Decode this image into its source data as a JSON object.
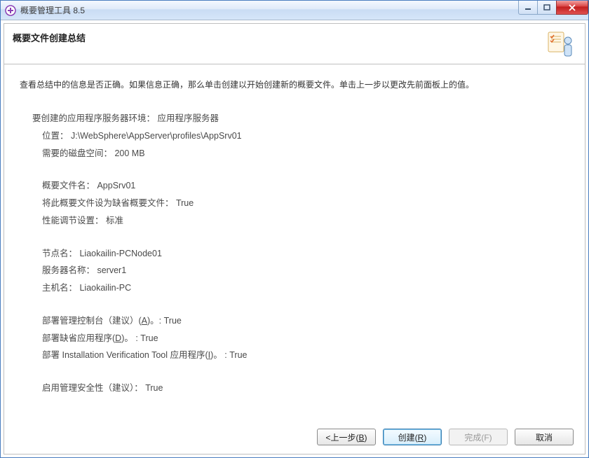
{
  "window": {
    "title": "概要管理工具 8.5"
  },
  "header": {
    "title": "概要文件创建总结"
  },
  "instruction": "查看总结中的信息是否正确。如果信息正确，那么单击创建以开始创建新的概要文件。单击上一步以更改先前面板上的值。",
  "summary": {
    "env": "要创建的应用程序服务器环境： 应用程序服务器",
    "location": "位置： J:\\WebSphere\\AppServer\\profiles\\AppSrv01",
    "disk": "需要的磁盘空间： 200 MB",
    "profileName": "概要文件名： AppSrv01",
    "defaultProfile": "将此概要文件设为缺省概要文件： True",
    "perf": "性能调节设置： 标准",
    "nodeName": "节点名： Liaokailin-PCNode01",
    "serverName": "服务器名称： server1",
    "hostName": "主机名： Liaokailin-PC",
    "adminConsolePre": "部署管理控制台（建议）(",
    "adminConsoleKey": "A",
    "adminConsolePost": ")。: True",
    "defaultAppPre": "部署缺省应用程序(",
    "defaultAppKey": "D",
    "defaultAppPost": ")。 : True",
    "ivtPre": "部署 Installation Verification Tool 应用程序(",
    "ivtKey": "I",
    "ivtPost": ")。 : True",
    "adminSec": "启用管理安全性（建议）： True"
  },
  "buttons": {
    "backPre": "<上一步(",
    "backKey": "B",
    "backPost": ")",
    "createPre": "创建(",
    "createKey": "R",
    "createPost": ")",
    "finishLabel": "完成(F)",
    "cancel": "取消"
  }
}
